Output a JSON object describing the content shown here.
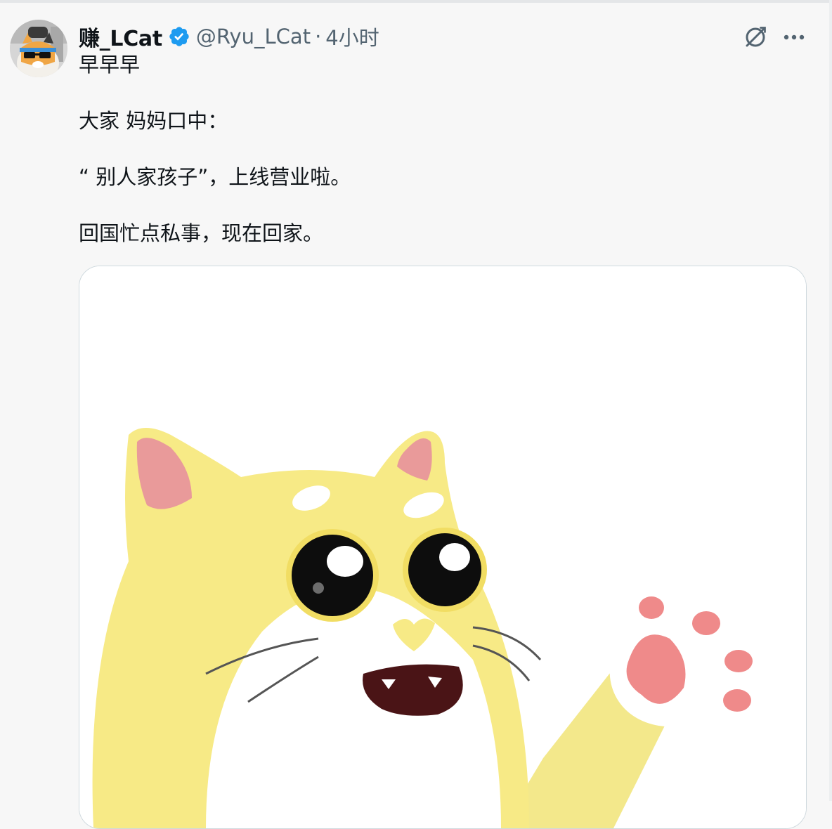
{
  "tweet": {
    "author": {
      "display_name": "赚_LCat",
      "handle": "@Ryu_LCat",
      "verified": true,
      "avatar_icon": "cat-avatar-with-sunglasses"
    },
    "separator": "·",
    "time": "4小时",
    "text_lines": [
      "早早早",
      "大家 妈妈口中：",
      "“ 别人家孩子”，上线营业啦。",
      "回国忙点私事，现在回家。"
    ],
    "actions": {
      "grok_icon": "grok-icon",
      "more_icon": "more-icon"
    },
    "media": {
      "kind": "image",
      "subject_icon": "yellow-cartoon-cat-waving"
    }
  },
  "colors": {
    "background": "#f7f7f7",
    "text": "#0f1419",
    "secondary": "#536471",
    "verified_blue": "#1d9bf0",
    "cat_yellow": "#f7ea86",
    "paw_pink": "#ef8a8a"
  }
}
